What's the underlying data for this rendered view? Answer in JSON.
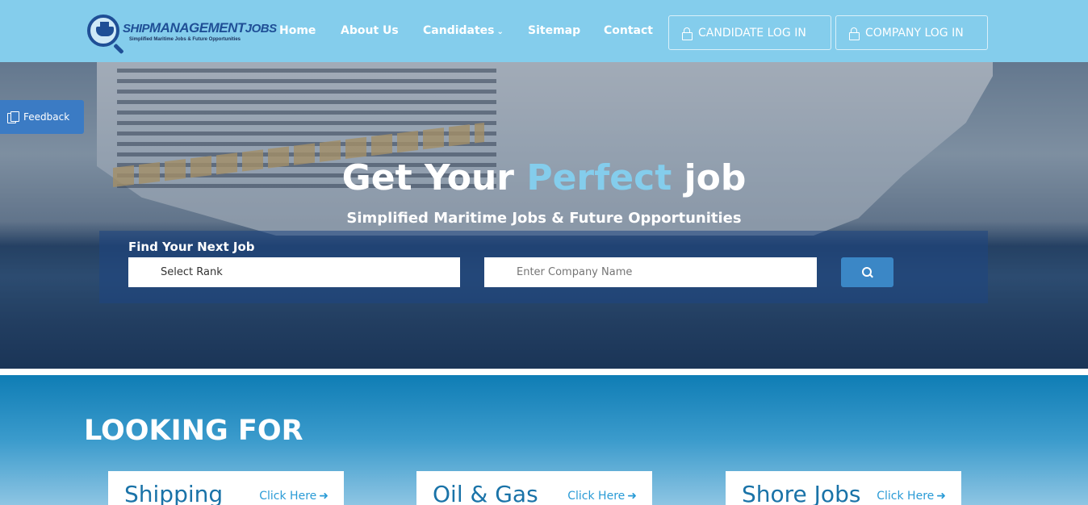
{
  "header": {
    "logo": {
      "title_prefix": "SHIP",
      "title_main": "MANAGEMENT",
      "title_suffix": "JOBS",
      "tagline": "Simplified Maritime Jobs & Future Opportunities"
    },
    "nav": [
      {
        "label": "Home"
      },
      {
        "label": "About Us"
      },
      {
        "label": "Candidates",
        "has_dropdown": true
      },
      {
        "label": "Sitemap"
      },
      {
        "label": "Contact"
      }
    ],
    "candidate_login": "CANDIDATE LOG IN",
    "company_login": "COMPANY LOG IN"
  },
  "hero": {
    "title_start": "Get Your",
    "title_accent": "Perfect",
    "title_end": "job",
    "subtitle": "Simplified Maritime Jobs & Future Opportunities",
    "search": {
      "label": "Find Your Next Job",
      "rank_value": "Select Rank",
      "company_placeholder": "Enter Company Name"
    }
  },
  "feedback": {
    "label": "Feedback"
  },
  "looking_for": {
    "title": "LOOKING FOR",
    "cards": [
      {
        "title": "Shipping",
        "link": "Click Here"
      },
      {
        "title": "Oil & Gas",
        "link": "Click Here"
      },
      {
        "title": "Shore Jobs",
        "link": "Click Here"
      }
    ]
  },
  "colors": {
    "header_bg": "#84cdec",
    "accent": "#84cdec",
    "brand_blue": "#1f4f96",
    "search_button": "#3b87c6",
    "card_title": "#1a73a8",
    "card_link": "#2a9bd6"
  },
  "icons": [
    "lock-icon",
    "search-icon",
    "document-icon",
    "chevron-down-icon",
    "arrow-right-icon"
  ]
}
